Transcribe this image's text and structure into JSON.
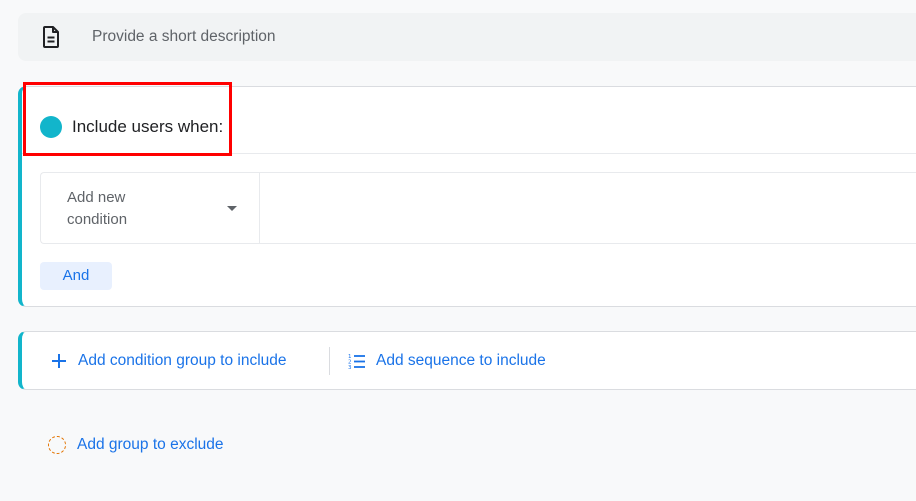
{
  "description": {
    "placeholder": "Provide a short description",
    "icon": "document-icon"
  },
  "include_group": {
    "title": "Include users when:",
    "accent_color": "#12b5cb",
    "condition_placeholder": "Add new condition",
    "and_label": "And"
  },
  "actions": {
    "add_condition_group": "Add condition group to include",
    "add_sequence": "Add sequence to include",
    "add_exclude_group": "Add group to exclude"
  },
  "colors": {
    "link": "#1a73e8",
    "highlight": "#ff0000",
    "exclude_ring": "#e37400"
  }
}
